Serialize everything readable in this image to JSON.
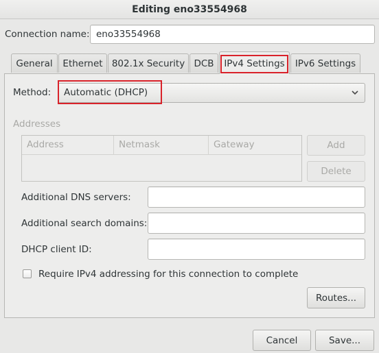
{
  "window": {
    "title": "Editing eno33554968"
  },
  "connection": {
    "label": "Connection name:",
    "value": "eno33554968"
  },
  "tabs": [
    {
      "label": "General",
      "active": false
    },
    {
      "label": "Ethernet",
      "active": false
    },
    {
      "label": "802.1x Security",
      "active": false
    },
    {
      "label": "DCB",
      "active": false
    },
    {
      "label": "IPv4 Settings",
      "active": true
    },
    {
      "label": "IPv6 Settings",
      "active": false
    }
  ],
  "ipv4": {
    "method_label": "Method:",
    "method_value": "Automatic (DHCP)",
    "addresses_heading": "Addresses",
    "columns": [
      "Address",
      "Netmask",
      "Gateway"
    ],
    "add_label": "Add",
    "delete_label": "Delete",
    "dns_label": "Additional DNS servers:",
    "dns_value": "",
    "search_label": "Additional search domains:",
    "search_value": "",
    "dhcp_label": "DHCP client ID:",
    "dhcp_value": "",
    "require_label": "Require IPv4 addressing for this connection to complete",
    "require_checked": false,
    "routes_label": "Routes..."
  },
  "footer": {
    "cancel_label": "Cancel",
    "save_label": "Save..."
  },
  "colors": {
    "highlight": "#d9222a",
    "window_bg": "#e8e8e7"
  }
}
